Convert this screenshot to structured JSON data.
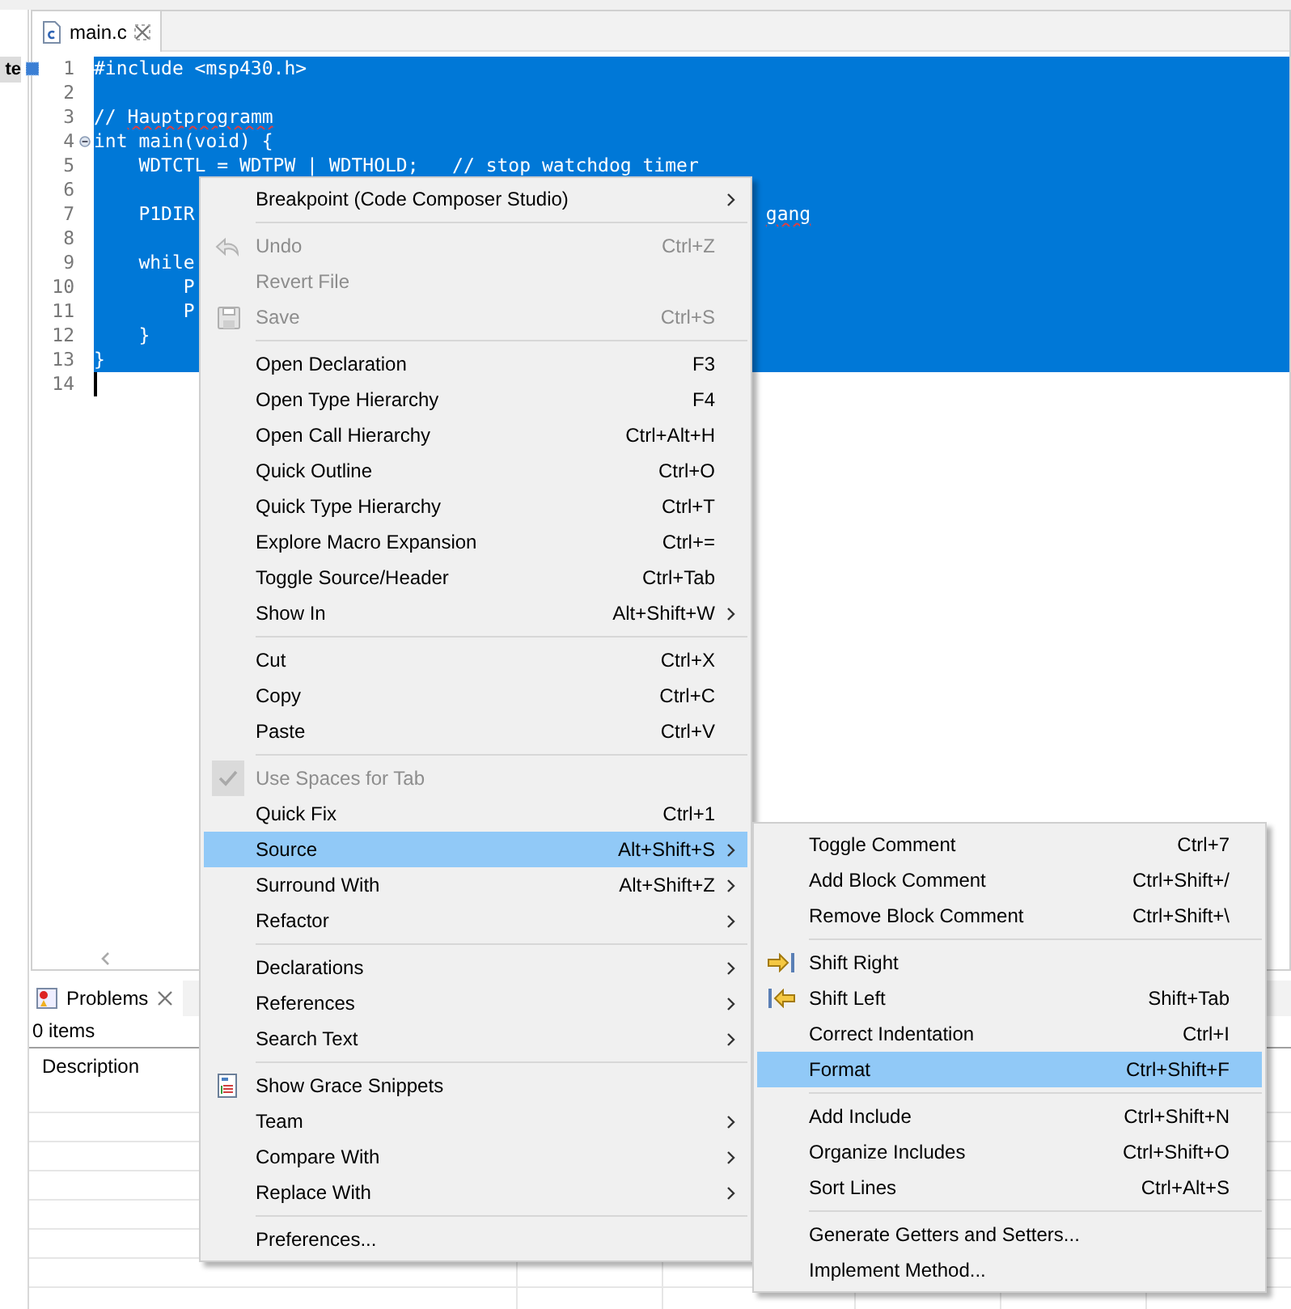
{
  "left_panel": {
    "tab_fragment": "te"
  },
  "editor": {
    "tab": {
      "label": "main.c",
      "selected": true
    },
    "lines": [
      {
        "number": "1",
        "selected": true,
        "segments": [
          {
            "text": "#include <msp430.h>",
            "misspelled": false
          }
        ]
      },
      {
        "number": "2",
        "selected": true
      },
      {
        "number": "3",
        "selected": true,
        "segments": [
          {
            "text": "// ",
            "misspelled": false
          },
          {
            "text": "Hauptprogramm",
            "misspelled": true
          }
        ]
      },
      {
        "number": "4",
        "selected": true,
        "fold_marker": true,
        "segments": [
          {
            "text": "int main(void) {",
            "misspelled": false
          }
        ]
      },
      {
        "number": "5",
        "selected": true,
        "segments": [
          {
            "text": "    WDTCTL = WDTPW | WDTHOLD;   // stop watchdog timer",
            "misspelled": false
          }
        ]
      },
      {
        "number": "6",
        "selected": true
      },
      {
        "number": "7",
        "selected": true,
        "segments": [
          {
            "text": "    P1DIR",
            "misspelled": false
          }
        ],
        "tail": {
          "text": "gang",
          "misspelled": true
        }
      },
      {
        "number": "8",
        "selected": true
      },
      {
        "number": "9",
        "selected": true,
        "segments": [
          {
            "text": "    while",
            "misspelled": false
          }
        ]
      },
      {
        "number": "10",
        "selected": true,
        "segments": [
          {
            "text": "        P",
            "misspelled": false
          }
        ]
      },
      {
        "number": "11",
        "selected": true,
        "segments": [
          {
            "text": "        P",
            "misspelled": false
          }
        ]
      },
      {
        "number": "12",
        "selected": true,
        "segments": [
          {
            "text": "    }",
            "misspelled": false
          }
        ]
      },
      {
        "number": "13",
        "selected": true,
        "segments": [
          {
            "text": "}",
            "misspelled": false
          }
        ]
      },
      {
        "number": "14",
        "selected": false,
        "cursor": true
      }
    ]
  },
  "problems": {
    "tab": {
      "label": "Problems",
      "selected": true
    },
    "summary": "0 items",
    "columns": [
      "Description"
    ]
  },
  "menu": {
    "items": [
      {
        "kind": "item",
        "label": "Breakpoint (Code Composer Studio)",
        "submenu": true,
        "disabled": false,
        "selected": false
      },
      {
        "kind": "separator"
      },
      {
        "kind": "undo",
        "label": "Undo",
        "shortcut": "Ctrl+Z",
        "disabled": true,
        "selected": false
      },
      {
        "kind": "item",
        "label": "Revert File",
        "disabled": true,
        "selected": false
      },
      {
        "kind": "save",
        "label": "Save",
        "shortcut": "Ctrl+S",
        "disabled": true,
        "selected": false
      },
      {
        "kind": "separator"
      },
      {
        "kind": "item",
        "label": "Open Declaration",
        "shortcut": "F3",
        "disabled": false,
        "selected": false
      },
      {
        "kind": "item",
        "label": "Open Type Hierarchy",
        "shortcut": "F4",
        "disabled": false,
        "selected": false
      },
      {
        "kind": "item",
        "label": "Open Call Hierarchy",
        "shortcut": "Ctrl+Alt+H",
        "disabled": false,
        "selected": false
      },
      {
        "kind": "item",
        "label": "Quick Outline",
        "shortcut": "Ctrl+O",
        "disabled": false,
        "selected": false
      },
      {
        "kind": "item",
        "label": "Quick Type Hierarchy",
        "shortcut": "Ctrl+T",
        "disabled": false,
        "selected": false
      },
      {
        "kind": "item",
        "label": "Explore Macro Expansion",
        "shortcut": "Ctrl+=",
        "disabled": false,
        "selected": false
      },
      {
        "kind": "item",
        "label": "Toggle Source/Header",
        "shortcut": "Ctrl+Tab",
        "disabled": false,
        "selected": false
      },
      {
        "kind": "item",
        "label": "Show In",
        "shortcut": "Alt+Shift+W",
        "submenu": true,
        "disabled": false,
        "selected": false
      },
      {
        "kind": "separator"
      },
      {
        "kind": "item",
        "label": "Cut",
        "shortcut": "Ctrl+X",
        "disabled": false,
        "selected": false
      },
      {
        "kind": "item",
        "label": "Copy",
        "shortcut": "Ctrl+C",
        "disabled": false,
        "selected": false
      },
      {
        "kind": "item",
        "label": "Paste",
        "shortcut": "Ctrl+V",
        "disabled": false,
        "selected": false
      },
      {
        "kind": "separator"
      },
      {
        "kind": "check",
        "label": "Use Spaces for Tab",
        "checked": true,
        "disabled": true,
        "selected": false
      },
      {
        "kind": "item",
        "label": "Quick Fix",
        "shortcut": "Ctrl+1",
        "disabled": false,
        "selected": false
      },
      {
        "kind": "item",
        "label": "Source",
        "shortcut": "Alt+Shift+S",
        "submenu": true,
        "disabled": false,
        "selected": true
      },
      {
        "kind": "item",
        "label": "Surround With",
        "shortcut": "Alt+Shift+Z",
        "submenu": true,
        "disabled": false,
        "selected": false
      },
      {
        "kind": "item",
        "label": "Refactor",
        "submenu": true,
        "disabled": false,
        "selected": false
      },
      {
        "kind": "separator"
      },
      {
        "kind": "item",
        "label": "Declarations",
        "submenu": true,
        "disabled": false,
        "selected": false
      },
      {
        "kind": "item",
        "label": "References",
        "submenu": true,
        "disabled": false,
        "selected": false
      },
      {
        "kind": "item",
        "label": "Search Text",
        "submenu": true,
        "disabled": false,
        "selected": false
      },
      {
        "kind": "separator"
      },
      {
        "kind": "snippets",
        "label": "Show Grace Snippets",
        "disabled": false,
        "selected": false
      },
      {
        "kind": "item",
        "label": "Team",
        "submenu": true,
        "disabled": false,
        "selected": false
      },
      {
        "kind": "item",
        "label": "Compare With",
        "submenu": true,
        "disabled": false,
        "selected": false
      },
      {
        "kind": "item",
        "label": "Replace With",
        "submenu": true,
        "disabled": false,
        "selected": false
      },
      {
        "kind": "separator"
      },
      {
        "kind": "item",
        "label": "Preferences...",
        "disabled": false,
        "selected": false
      }
    ]
  },
  "submenu": {
    "items": [
      {
        "kind": "item",
        "label": "Toggle Comment",
        "shortcut": "Ctrl+7",
        "disabled": false,
        "selected": false
      },
      {
        "kind": "item",
        "label": "Add Block Comment",
        "shortcut": "Ctrl+Shift+/",
        "disabled": false,
        "selected": false
      },
      {
        "kind": "item",
        "label": "Remove Block Comment",
        "shortcut": "Ctrl+Shift+\\",
        "disabled": false,
        "selected": false
      },
      {
        "kind": "separator"
      },
      {
        "kind": "shift-right",
        "label": "Shift Right",
        "disabled": false,
        "selected": false
      },
      {
        "kind": "shift-left",
        "label": "Shift Left",
        "shortcut": "Shift+Tab",
        "disabled": false,
        "selected": false
      },
      {
        "kind": "item",
        "label": "Correct Indentation",
        "shortcut": "Ctrl+I",
        "disabled": false,
        "selected": false
      },
      {
        "kind": "item",
        "label": "Format",
        "shortcut": "Ctrl+Shift+F",
        "disabled": false,
        "selected": true
      },
      {
        "kind": "separator"
      },
      {
        "kind": "item",
        "label": "Add Include",
        "shortcut": "Ctrl+Shift+N",
        "disabled": false,
        "selected": false
      },
      {
        "kind": "item",
        "label": "Organize Includes",
        "shortcut": "Ctrl+Shift+O",
        "disabled": false,
        "selected": false
      },
      {
        "kind": "item",
        "label": "Sort Lines",
        "shortcut": "Ctrl+Alt+S",
        "disabled": false,
        "selected": false
      },
      {
        "kind": "separator"
      },
      {
        "kind": "item",
        "label": "Generate Getters and Setters...",
        "disabled": false,
        "selected": false
      },
      {
        "kind": "item",
        "label": "Implement Method...",
        "disabled": false,
        "selected": false
      }
    ]
  }
}
